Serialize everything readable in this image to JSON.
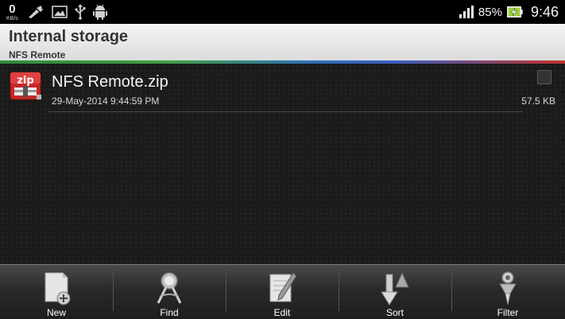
{
  "status_bar": {
    "data_rate_value": "0",
    "data_rate_unit": "KB/s",
    "battery_percent": "85%",
    "time": "9:46",
    "icons": [
      "usb-debug-icon",
      "image-icon",
      "usb-icon",
      "android-icon",
      "signal-icon",
      "battery-charging-icon"
    ]
  },
  "header": {
    "title": "Internal storage",
    "path": "NFS Remote"
  },
  "files": [
    {
      "name": "NFS Remote.zip",
      "date": "29-May-2014 9:44:59 PM",
      "size": "57.5 KB",
      "icon_text": "zip",
      "checked": false
    }
  ],
  "toolbar": {
    "new_label": "New",
    "find_label": "Find",
    "edit_label": "Edit",
    "sort_label": "Sort",
    "filter_label": "Filter"
  },
  "colors": {
    "status_bar_bg": "#000000",
    "header_bg": "#e8e8e8",
    "list_bg": "#1b1b1b",
    "zip_icon_red": "#c82828",
    "rule_green": "#3fa045",
    "rule_blue": "#2f6fb8",
    "rule_red": "#c4342c"
  }
}
